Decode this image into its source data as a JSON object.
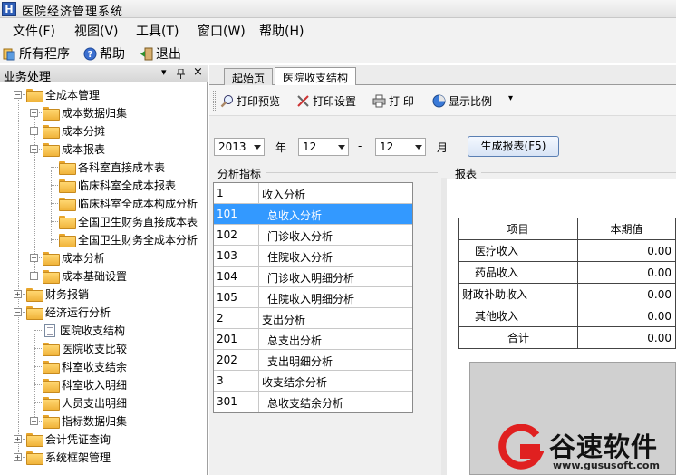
{
  "window": {
    "title": "医院经济管理系统",
    "icon_letter": "H"
  },
  "menu": [
    {
      "label": "文件(F)"
    },
    {
      "label": "视图(V)"
    },
    {
      "label": "工具(T)"
    },
    {
      "label": "窗口(W)"
    },
    {
      "label": "帮助(H)"
    }
  ],
  "quickbar": {
    "all_programs": "所有程序",
    "help": "帮助",
    "exit": "退出"
  },
  "left_panel": {
    "title": "业务处理",
    "controls": {
      "dropdown": "▾",
      "pin": "📌",
      "close": "×"
    },
    "tree": [
      {
        "label": "全成本管理",
        "expander": "−",
        "icon": "folder-icon"
      },
      {
        "label": "成本数据归集",
        "expander": "+",
        "icon": "folder-icon"
      },
      {
        "label": "成本分摊",
        "expander": "+",
        "icon": "folder-icon"
      },
      {
        "label": "成本报表",
        "expander": "−",
        "icon": "folder-icon"
      },
      {
        "label": "各科室直接成本表",
        "icon": "folder-icon"
      },
      {
        "label": "临床科室全成本报表",
        "icon": "folder-icon"
      },
      {
        "label": "临床科室全成本构成分析",
        "icon": "folder-icon"
      },
      {
        "label": "全国卫生财务直接成本表",
        "icon": "folder-icon"
      },
      {
        "label": "全国卫生财务全成本分析",
        "icon": "folder-icon"
      },
      {
        "label": "成本分析",
        "expander": "+",
        "icon": "folder-icon"
      },
      {
        "label": "成本基础设置",
        "expander": "+",
        "icon": "folder-icon"
      },
      {
        "label": "财务报销",
        "expander": "+",
        "icon": "folder-icon"
      },
      {
        "label": "经济运行分析",
        "expander": "−",
        "icon": "folder-icon"
      },
      {
        "label": "医院收支结构",
        "icon": "document-icon"
      },
      {
        "label": "医院收支比较",
        "icon": "folder-icon"
      },
      {
        "label": "科室收支结余",
        "icon": "folder-icon"
      },
      {
        "label": "科室收入明细",
        "icon": "folder-icon"
      },
      {
        "label": "人员支出明细",
        "icon": "folder-icon"
      },
      {
        "label": "指标数据归集",
        "expander": "+",
        "icon": "folder-icon"
      },
      {
        "label": "会计凭证查询",
        "expander": "+",
        "icon": "folder-icon"
      },
      {
        "label": "系统框架管理",
        "expander": "+",
        "icon": "folder-icon"
      }
    ]
  },
  "tabs": [
    {
      "label": "起始页",
      "active": false
    },
    {
      "label": "医院收支结构",
      "active": true
    }
  ],
  "toolbar": {
    "print_preview": "打印预览",
    "print_settings": "打印设置",
    "print": "打 印",
    "display_ratio": "显示比例",
    "more": "▾"
  },
  "filters": {
    "year": "2013",
    "year_label": "年",
    "month_from": "12",
    "separator": "-",
    "month_to": "12",
    "month_label": "月",
    "generate_button": "生成报表(F5)"
  },
  "indicators": {
    "section_label": "分析指标",
    "rows": [
      {
        "code": "1",
        "name": "收入分析",
        "selected": false
      },
      {
        "code": "101",
        "name": "总收入分析",
        "selected": true
      },
      {
        "code": "102",
        "name": "门诊收入分析",
        "selected": false
      },
      {
        "code": "103",
        "name": "住院收入分析",
        "selected": false
      },
      {
        "code": "104",
        "name": "门诊收入明细分析",
        "selected": false
      },
      {
        "code": "105",
        "name": "住院收入明细分析",
        "selected": false
      },
      {
        "code": "2",
        "name": "支出分析",
        "selected": false
      },
      {
        "code": "201",
        "name": "总支出分析",
        "selected": false
      },
      {
        "code": "202",
        "name": "支出明细分析",
        "selected": false
      },
      {
        "code": "3",
        "name": "收支结余分析",
        "selected": false
      },
      {
        "code": "301",
        "name": "总收支结余分析",
        "selected": false
      }
    ]
  },
  "report": {
    "section_label": "报表",
    "headers": [
      "项目",
      "本期值"
    ],
    "rows": [
      {
        "item": "医疗收入",
        "value": "0.00"
      },
      {
        "item": "药品收入",
        "value": "0.00"
      },
      {
        "item": "财政补助收入",
        "value": "0.00"
      },
      {
        "item": "其他收入",
        "value": "0.00"
      },
      {
        "item": "合计",
        "value": "0.00"
      }
    ]
  },
  "watermark": {
    "text": "谷速软件",
    "url": "www.gususoft.com"
  },
  "colors": {
    "selection": "#3399ff",
    "folder": "#f0b33a",
    "brand_red": "#e02020"
  }
}
